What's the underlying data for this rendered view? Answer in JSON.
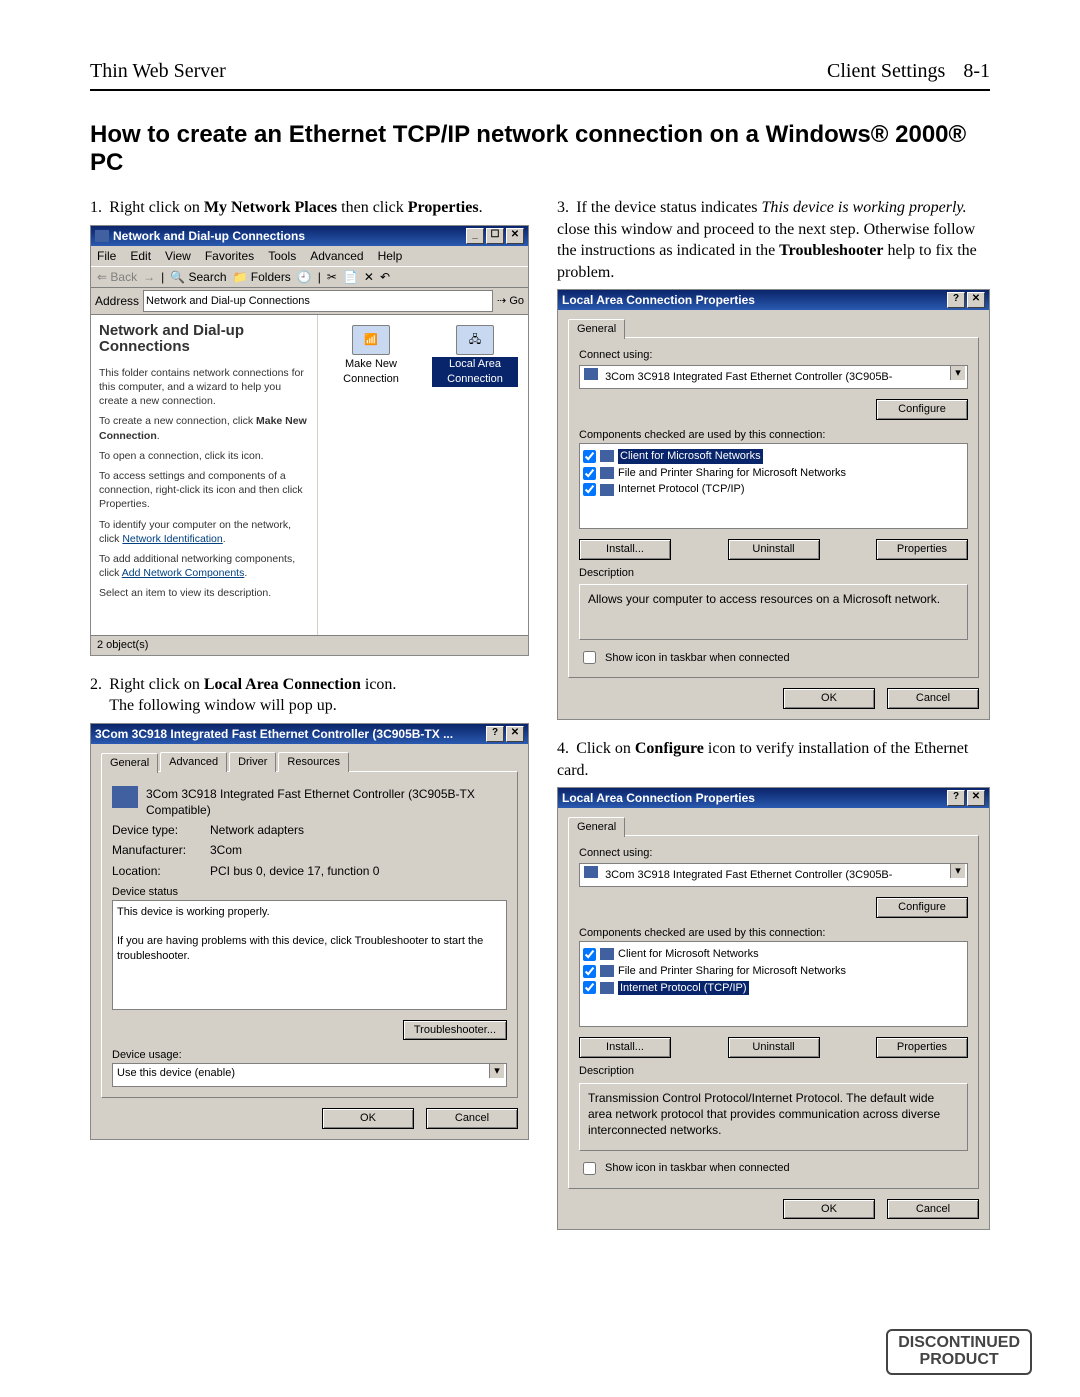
{
  "header": {
    "left": "Thin Web Server",
    "right_label": "Client Settings",
    "page_num": "8-1"
  },
  "title": "How to create an Ethernet TCP/IP network connection on a Windows® 2000® PC",
  "step1": {
    "num": "1.",
    "text_a": "Right click on ",
    "bold_a": "My Network Places",
    "text_b": " then click ",
    "bold_b": "Properties",
    "text_c": "."
  },
  "step2": {
    "num": "2.",
    "line_a": "Right click on ",
    "bold": "Local Area Connection",
    "line_b": " icon.",
    "line_c": "The following window will pop up."
  },
  "step3": {
    "num": "3.",
    "t1": "If the device status indicates ",
    "italic": "This device is working properly.",
    "t2": "  close this window and proceed to the next step. Otherwise follow the instructions as indicated in the ",
    "b1": "Troubleshooter",
    "t3": " help to fix the problem."
  },
  "step4": {
    "num": "4.",
    "t1": "Click on ",
    "b1": "Configure",
    "t2": " icon to verify installation of the Ethernet card."
  },
  "explorer": {
    "title": "Network and Dial-up Connections",
    "menus": [
      "File",
      "Edit",
      "View",
      "Favorites",
      "Tools",
      "Advanced",
      "Help"
    ],
    "toolbar": {
      "back": "Back",
      "search": "Search",
      "folders": "Folders"
    },
    "address_label": "Address",
    "address_value": "Network and Dial-up Connections",
    "go": "Go",
    "left": {
      "head": "Network and Dial-up Connections",
      "p1": "This folder contains network connections for this computer, and a wizard to help you create a new connection.",
      "p2a": "To create a new connection, click ",
      "p2b": "Make New Connection",
      "p2c": ".",
      "p3": "To open a connection, click its icon.",
      "p4": "To access settings and components of a connection, right-click its icon and then click Properties.",
      "p5a": "To identify your computer on the network, click ",
      "p5link": "Network Identification",
      "p5c": ".",
      "p6a": "To add additional networking components, click ",
      "p6link": "Add Network Components",
      "p6c": ".",
      "p7": "Select an item to view its description."
    },
    "icons": {
      "makenew": "Make New Connection",
      "lac": "Local Area Connection"
    },
    "status": "2 object(s)"
  },
  "device": {
    "title": "3Com 3C918 Integrated Fast Ethernet Controller (3C905B-TX ...",
    "tabs": [
      "General",
      "Advanced",
      "Driver",
      "Resources"
    ],
    "name": "3Com 3C918 Integrated Fast Ethernet Controller (3C905B-TX Compatible)",
    "fields": {
      "devtype_k": "Device type:",
      "devtype_v": "Network adapters",
      "manu_k": "Manufacturer:",
      "manu_v": "3Com",
      "loc_k": "Location:",
      "loc_v": "PCI bus 0, device 17, function 0"
    },
    "status_label": "Device status",
    "status_line1": "This device is working properly.",
    "status_line2": "If you are having problems with this device, click Troubleshooter to start the troubleshooter.",
    "troubleshooter": "Troubleshooter...",
    "usage_label": "Device usage:",
    "usage_value": "Use this device (enable)",
    "ok": "OK",
    "cancel": "Cancel"
  },
  "lac": {
    "title": "Local Area Connection Properties",
    "tab": "General",
    "connect_using": "Connect using:",
    "adapter": "3Com 3C918 Integrated Fast Ethernet Controller (3C905B-",
    "configure": "Configure",
    "components_label": "Components checked are used by this connection:",
    "items": [
      "Client for Microsoft Networks",
      "File and Printer Sharing for Microsoft Networks",
      "Internet Protocol (TCP/IP)"
    ],
    "install": "Install...",
    "uninstall": "Uninstall",
    "properties": "Properties",
    "description_label": "Description",
    "descA": "Allows your computer to access resources on a Microsoft network.",
    "descB": "Transmission Control Protocol/Internet Protocol. The default wide area network protocol that provides communication across diverse interconnected networks.",
    "show_icon": "Show icon in taskbar when connected",
    "ok": "OK",
    "cancel": "Cancel"
  },
  "stamp": {
    "l1": "DISCONTINUED",
    "l2": "PRODUCT"
  }
}
